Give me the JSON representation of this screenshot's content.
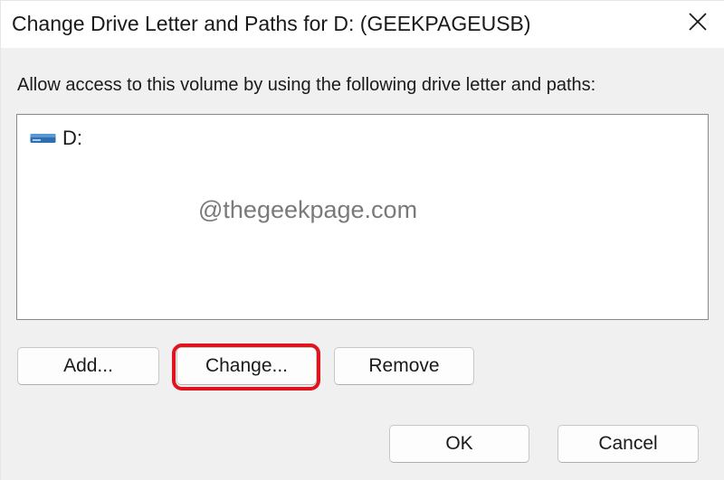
{
  "window": {
    "title": "Change Drive Letter and Paths for D: (GEEKPAGEUSB)",
    "close_icon": "close-icon"
  },
  "instruction": "Allow access to this volume by using the following drive letter and paths:",
  "path_list": {
    "items": [
      {
        "icon": "drive-icon",
        "label": "D:"
      }
    ]
  },
  "watermark": "@thegeekpage.com",
  "buttons": {
    "add": "Add...",
    "change": "Change...",
    "remove": "Remove",
    "ok": "OK",
    "cancel": "Cancel"
  },
  "highlight": {
    "target": "change",
    "color": "#e0141e"
  }
}
